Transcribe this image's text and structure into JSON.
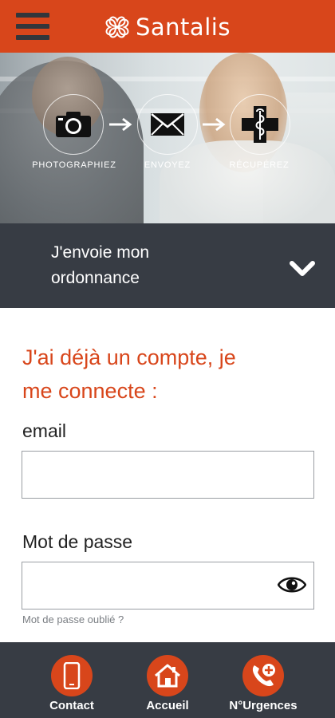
{
  "header": {
    "brand_name": "Santalis",
    "menu_icon": "hamburger-menu-icon",
    "logo_icon": "clover-logo-icon"
  },
  "hero": {
    "steps": [
      {
        "label": "PHOTOGRAPHIEZ",
        "icon": "camera-icon"
      },
      {
        "label": "ENVOYEZ",
        "icon": "envelope-icon"
      },
      {
        "label": "RÉCUPÉREZ",
        "icon": "pharmacy-cross-icon"
      }
    ]
  },
  "prescription_bar": {
    "line1": "J'envoie mon",
    "line2": "ordonnance",
    "toggle_icon": "chevron-down-icon"
  },
  "login": {
    "title_line1": "J'ai déjà un compte, je",
    "title_line2": "me connecte :",
    "email_label": "email",
    "email_value": "",
    "password_label": "Mot de passe",
    "password_value": "",
    "show_password_icon": "eye-icon",
    "forgot_link": "Mot de passe oublié ?"
  },
  "bottom_nav": {
    "items": [
      {
        "label": "Contact",
        "icon": "phone-icon"
      },
      {
        "label": "Accueil",
        "icon": "home-icon"
      },
      {
        "label": "N°Urgences",
        "icon": "emergency-call-icon"
      }
    ]
  },
  "colors": {
    "brand_orange": "#d8461b",
    "dark_bar": "#373c44",
    "white": "#ffffff"
  }
}
